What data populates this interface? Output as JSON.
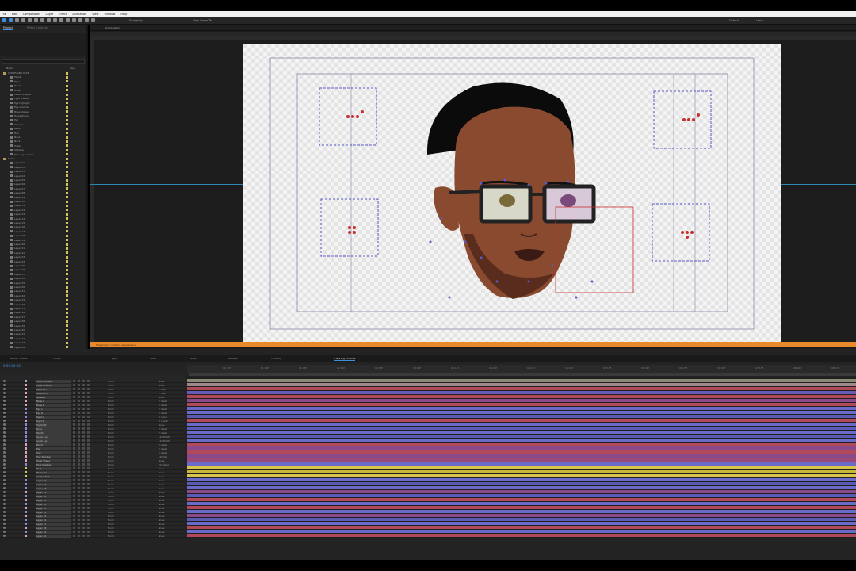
{
  "menu": [
    "File",
    "Edit",
    "Composition",
    "Layer",
    "Effect",
    "Animation",
    "View",
    "Window",
    "Help"
  ],
  "toolbar": {
    "snapping_label": "Snapping",
    "align_label": "Align Layer To",
    "default_label": "Default",
    "learn_label": "Learn"
  },
  "project_panel": {
    "tab_project": "Project",
    "tab_effects": "Effect Controls",
    "col_name": "Name",
    "col_type": "Type",
    "items": [
      "COMPS AND FACE",
      "Mouth",
      "Eyes",
      "Head",
      "Brows",
      "Mouth shapes",
      "Eyes shapes",
      "Eye highlight",
      "Eye shadow",
      "Brow shapes",
      "Head shape",
      "Ear",
      "Glasses",
      "Beard",
      "Hair",
      "Nose",
      "Neck",
      "Pupils",
      "Shadow",
      "Face rig controls",
      "Solids",
      "Layer 01",
      "Layer 02",
      "Layer 03",
      "Layer 04",
      "Layer 05",
      "Layer 06",
      "Layer 07",
      "Layer 08",
      "Layer 09",
      "Layer 10",
      "Layer 11",
      "Layer 12",
      "Layer 13",
      "Layer 14",
      "Layer 15",
      "Layer 16",
      "Layer 17",
      "Layer 18",
      "Layer 19",
      "Layer 20",
      "Layer 21",
      "Layer 22",
      "Layer 23",
      "Layer 24",
      "Layer 25",
      "Layer 26",
      "Layer 27",
      "Layer 28",
      "Layer 29",
      "Layer 30",
      "Layer 31",
      "Layer 32",
      "Layer 33",
      "Layer 34",
      "Layer 35",
      "Layer 36",
      "Layer 37",
      "Layer 38",
      "Layer 39",
      "Layer 40",
      "Layer 41",
      "Layer 42",
      "Layer 43",
      "Layer 44",
      "Layer 45",
      "Layer 46",
      "Layer 47"
    ]
  },
  "composition": {
    "tab_label": "Composition",
    "warning_text": "This project contains expressions",
    "bg_color": "#f4f4f4",
    "skin_color": "#8a4a2f",
    "hair_color": "#0b0b0b",
    "guide_color": "#5a5ac8"
  },
  "timeline": {
    "timecode": "0:00:00:00",
    "tabs": [
      "Render Queue",
      "Mouth",
      "Eyes",
      "Head",
      "Brows",
      "Glasses",
      "Face Rig",
      "Face Rig Controls"
    ],
    "active_tab": "Face Rig Controls",
    "ruler_ticks": [
      "00:15f",
      "01:00f",
      "01:15f",
      "02:00f",
      "02:15f",
      "03:00f",
      "03:15f",
      "04:00f",
      "04:15f",
      "05:00f",
      "05:15f",
      "06:00f",
      "06:15f",
      "07:00f",
      "07:15f",
      "08:00f",
      "08:15f"
    ],
    "col_source": "Source Name",
    "col_mode": "Mode",
    "col_parent": "Parent & Link",
    "layers": [
      {
        "name": "Face Controls",
        "mode": "Norm",
        "parent": "None",
        "color": "#b0a0e0",
        "track": "#8a8a78"
      },
      {
        "name": "Head Rotation",
        "mode": "Norm",
        "parent": "None",
        "color": "#e0a0c0",
        "track": "#a08888"
      },
      {
        "name": "Eyes Ctrl",
        "mode": "Norm",
        "parent": "1. Face",
        "color": "#e0a0c0",
        "track": "#b04a5a"
      },
      {
        "name": "Mouth Ctrl",
        "mode": "Norm",
        "parent": "1. Face",
        "color": "#e0a0c0",
        "track": "#6a5ab8"
      },
      {
        "name": "Glasses",
        "mode": "Norm",
        "parent": "None",
        "color": "#e0a0c0",
        "track": "#b04a5a"
      },
      {
        "name": "Brow L",
        "mode": "Norm",
        "parent": "2. Head",
        "color": "#e0a0c0",
        "track": "#8a4a8a"
      },
      {
        "name": "Brow R",
        "mode": "Norm",
        "parent": "2. Head",
        "color": "#e0a0c0",
        "track": "#b04a5a"
      },
      {
        "name": "Eye L",
        "mode": "Norm",
        "parent": "2. Head",
        "color": "#8a8ad8",
        "track": "#6a6ac8"
      },
      {
        "name": "Eye R",
        "mode": "Norm",
        "parent": "2. Head",
        "color": "#8a8ad8",
        "track": "#6a6ac8"
      },
      {
        "name": "Pupil L",
        "mode": "Norm",
        "parent": "8. Eye L",
        "color": "#8a8ad8",
        "track": "#5a5ab0"
      },
      {
        "name": "Pupil R",
        "mode": "Norm",
        "parent": "9. Eye R",
        "color": "#e0a0c0",
        "track": "#b04a5a"
      },
      {
        "name": "Highlight",
        "mode": "Norm",
        "parent": "None",
        "color": "#8a8ad8",
        "track": "#6a6ac8"
      },
      {
        "name": "Nose",
        "mode": "Norm",
        "parent": "2. Head",
        "color": "#8a8ad8",
        "track": "#5a5ab8"
      },
      {
        "name": "Mouth",
        "mode": "Norm",
        "parent": "2. Head",
        "color": "#8a8ad8",
        "track": "#6a6ac8"
      },
      {
        "name": "Upper Lip",
        "mode": "Norm",
        "parent": "14. Mouth",
        "color": "#8a8ad8",
        "track": "#5a5ab0"
      },
      {
        "name": "Lower Lip",
        "mode": "Norm",
        "parent": "14. Mouth",
        "color": "#8a8ad8",
        "track": "#6a6ac8"
      },
      {
        "name": "Beard",
        "mode": "Norm",
        "parent": "2. Head",
        "color": "#e0a0c0",
        "track": "#b04a5a"
      },
      {
        "name": "Ear",
        "mode": "Norm",
        "parent": "2. Head",
        "color": "#e0a0c0",
        "track": "#8a4a8a"
      },
      {
        "name": "Hair",
        "mode": "Norm",
        "parent": "2. Head",
        "color": "#e0a0c0",
        "track": "#b04a5a"
      },
      {
        "name": "Hair Shadow",
        "mode": "Norm",
        "parent": "19. Hair",
        "color": "#e0a0c0",
        "track": "#8a4a8a"
      },
      {
        "name": "Head Shape",
        "mode": "Norm",
        "parent": "None",
        "color": "#e0a0c0",
        "track": "#9a4a78"
      },
      {
        "name": "Face Shadow",
        "mode": "Norm",
        "parent": "21. Head",
        "color": "#8a8ad8",
        "track": "#6a6ac8"
      },
      {
        "name": "Neck",
        "mode": "Norm",
        "parent": "None",
        "color": "#d8c25a",
        "track": "#d8c44a"
      },
      {
        "name": "BG Guide",
        "mode": "Norm",
        "parent": "None",
        "color": "#d8c25a",
        "track": "#c8b83a"
      },
      {
        "name": "Control Null",
        "mode": "Norm",
        "parent": "None",
        "color": "#d8c25a",
        "track": "#d8c44a"
      },
      {
        "name": "Layer 26",
        "mode": "Norm",
        "parent": "None",
        "color": "#8a8ad8",
        "track": "#6a6ac8"
      },
      {
        "name": "Layer 27",
        "mode": "Norm",
        "parent": "None",
        "color": "#8a8ad8",
        "track": "#5a5ab0"
      },
      {
        "name": "Layer 28",
        "mode": "Norm",
        "parent": "None",
        "color": "#8a8ad8",
        "track": "#6a6ac8"
      },
      {
        "name": "Layer 29",
        "mode": "Norm",
        "parent": "None",
        "color": "#e0a0c0",
        "track": "#8a4a8a"
      },
      {
        "name": "Layer 30",
        "mode": "Norm",
        "parent": "None",
        "color": "#8a8ad8",
        "track": "#5a5ab8"
      },
      {
        "name": "Layer 31",
        "mode": "Norm",
        "parent": "None",
        "color": "#e0a0c0",
        "track": "#b04a5a"
      },
      {
        "name": "Layer 32",
        "mode": "Norm",
        "parent": "None",
        "color": "#8a8ad8",
        "track": "#6a6ac8"
      },
      {
        "name": "Layer 33",
        "mode": "Norm",
        "parent": "None",
        "color": "#e0a0c0",
        "track": "#b04a5a"
      },
      {
        "name": "Layer 34",
        "mode": "Norm",
        "parent": "None",
        "color": "#8a8ad8",
        "track": "#6a6ac8"
      },
      {
        "name": "Layer 35",
        "mode": "Norm",
        "parent": "None",
        "color": "#e0a0c0",
        "track": "#8a4a8a"
      },
      {
        "name": "Layer 36",
        "mode": "Norm",
        "parent": "None",
        "color": "#8a8ad8",
        "track": "#5a5ab0"
      },
      {
        "name": "Layer 37",
        "mode": "Norm",
        "parent": "None",
        "color": "#8a8ad8",
        "track": "#6a6ac8"
      },
      {
        "name": "Layer 38",
        "mode": "Norm",
        "parent": "None",
        "color": "#e0a0c0",
        "track": "#b04a5a"
      },
      {
        "name": "Layer 39",
        "mode": "Norm",
        "parent": "None",
        "color": "#8a8ad8",
        "track": "#6a6ac8"
      },
      {
        "name": "Layer 40",
        "mode": "Norm",
        "parent": "None",
        "color": "#e0a0c0",
        "track": "#b04a5a"
      }
    ]
  }
}
